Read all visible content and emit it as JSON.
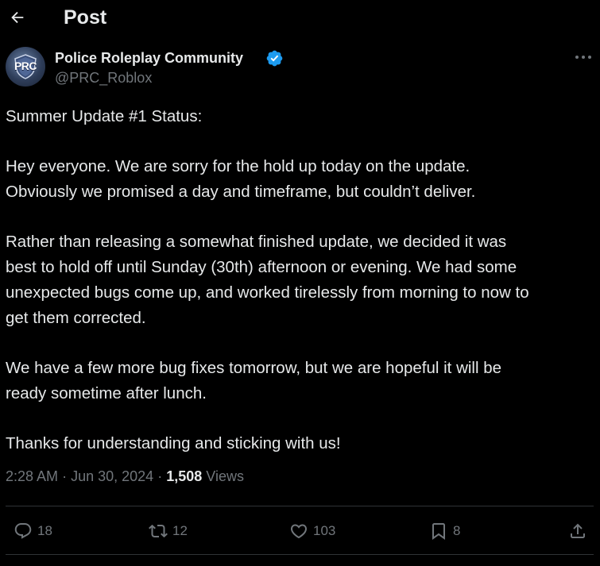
{
  "header": {
    "title": "Post",
    "back_icon": "arrow-left-icon"
  },
  "author": {
    "display_name": "Police Roleplay Community",
    "handle": "@PRC_Roblox",
    "avatar_text": "PRC",
    "verified": true,
    "verified_color": "#1d9bf0"
  },
  "post": {
    "lines": [
      "Summer Update #1 Status:",
      "Hey everyone. We are sorry for the hold up today on the update.",
      "Obviously we promised a day and timeframe, but couldn’t deliver.",
      "Rather than releasing a somewhat finished update, we decided it was",
      "best to hold off until Sunday (30th) afternoon or evening. We had some",
      "unexpected bugs come up, and worked tirelessly from morning to now to",
      "get them corrected.",
      "We have a few more bug fixes tomorrow, but we are hopeful it will be",
      "ready sometime after lunch.",
      "Thanks for understanding and sticking with us!"
    ]
  },
  "meta": {
    "time": "2:28 AM",
    "date": "Jun 30, 2024",
    "separator": "·",
    "views_count": "1,508",
    "views_label": "Views"
  },
  "actions": {
    "replies": "18",
    "reposts": "12",
    "likes": "103",
    "bookmarks": "8"
  },
  "colors": {
    "background": "#000000",
    "text": "#e7e9ea",
    "muted": "#71767b",
    "divider": "#2f3336"
  }
}
